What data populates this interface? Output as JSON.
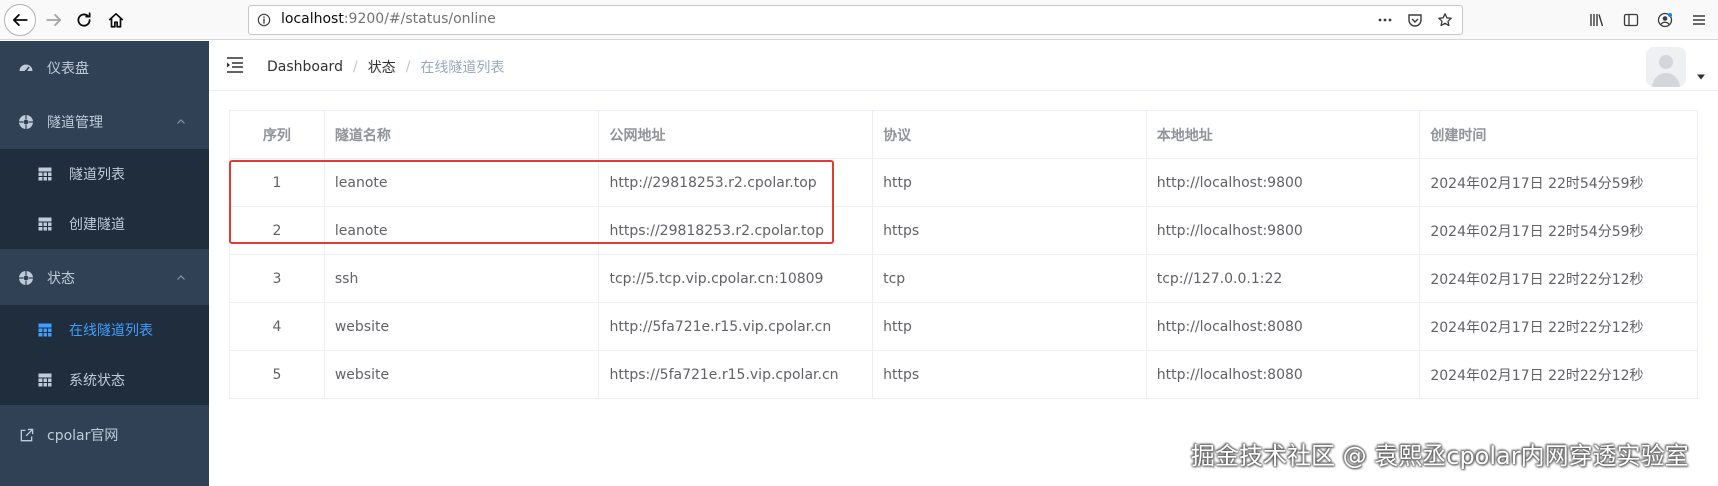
{
  "browser": {
    "url_host": "localhost",
    "url_rest": ":9200/#/status/online"
  },
  "sidebar": {
    "items": [
      {
        "label": "仪表盘",
        "icon": "dashboard-icon"
      },
      {
        "label": "隧道管理",
        "icon": "tunnel-icon",
        "expanded": true,
        "children": [
          {
            "label": "隧道列表",
            "icon": "table-icon"
          },
          {
            "label": "创建隧道",
            "icon": "table-icon"
          }
        ]
      },
      {
        "label": "状态",
        "icon": "status-icon",
        "expanded": true,
        "children": [
          {
            "label": "在线隧道列表",
            "icon": "table-icon",
            "active": true
          },
          {
            "label": "系统状态",
            "icon": "table-icon"
          }
        ]
      },
      {
        "label": "cpolar官网",
        "icon": "external-link-icon"
      }
    ]
  },
  "breadcrumb": [
    "Dashboard",
    "状态",
    "在线隧道列表"
  ],
  "table": {
    "headers": [
      "序列",
      "隧道名称",
      "公网地址",
      "协议",
      "本地地址",
      "创建时间"
    ],
    "rows": [
      [
        "1",
        "leanote",
        "http://29818253.r2.cpolar.top",
        "http",
        "http://localhost:9800",
        "2024年02月17日 22时54分59秒"
      ],
      [
        "2",
        "leanote",
        "https://29818253.r2.cpolar.top",
        "https",
        "http://localhost:9800",
        "2024年02月17日 22时54分59秒"
      ],
      [
        "3",
        "ssh",
        "tcp://5.tcp.vip.cpolar.cn:10809",
        "tcp",
        "tcp://127.0.0.1:22",
        "2024年02月17日 22时22分12秒"
      ],
      [
        "4",
        "website",
        "http://5fa721e.r15.vip.cpolar.cn",
        "http",
        "http://localhost:8080",
        "2024年02月17日 22时22分12秒"
      ],
      [
        "5",
        "website",
        "https://5fa721e.r15.vip.cpolar.cn",
        "https",
        "http://localhost:8080",
        "2024年02月17日 22时22分12秒"
      ]
    ]
  },
  "watermark": "掘金技术社区 @ 袁熙丞cpolar内网穿透实验室",
  "colors": {
    "sidebar_bg": "#304156",
    "submenu_bg": "#1f2d3d",
    "active": "#409eff",
    "highlight": "#e53935"
  }
}
